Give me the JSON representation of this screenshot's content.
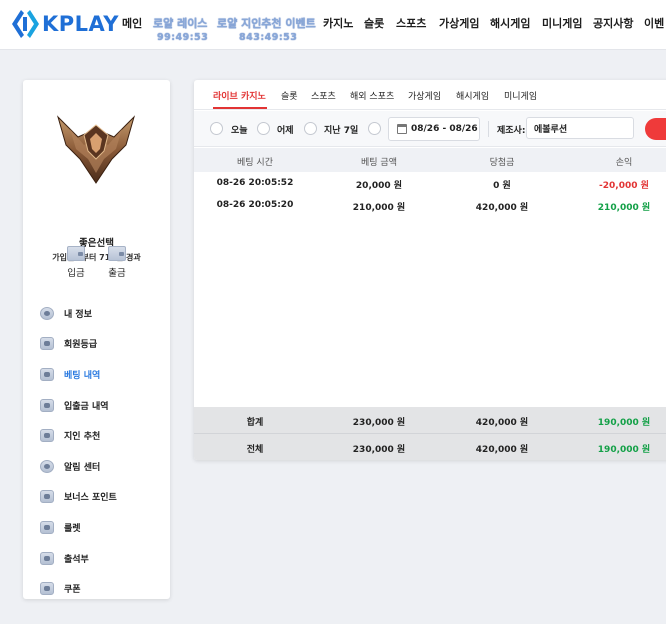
{
  "header": {
    "logo_text": "KPLAY",
    "nav": [
      {
        "label": "메인",
        "event": false
      },
      {
        "label": "로얄 레이스",
        "event": true,
        "timer": "99:49:53"
      },
      {
        "label": "로얄 지인추천 이벤트",
        "event": true,
        "timer": "843:49:53"
      },
      {
        "label": "카지노",
        "event": false
      },
      {
        "label": "슬롯",
        "event": false
      },
      {
        "label": "스포츠",
        "event": false
      },
      {
        "label": "가상게임",
        "event": false
      },
      {
        "label": "해시게임",
        "event": false
      },
      {
        "label": "미니게임",
        "event": false
      },
      {
        "label": "공지사항",
        "event": false
      },
      {
        "label": "이벤",
        "event": false
      }
    ]
  },
  "profile": {
    "username": "좋은선택",
    "joined": "가입일로부터 719일 경과",
    "deposit_label": "입금",
    "withdraw_label": "출금"
  },
  "menu": [
    {
      "label": "내 정보",
      "icon": "user-icon",
      "active": false
    },
    {
      "label": "회원등급",
      "icon": "badge-icon",
      "active": false
    },
    {
      "label": "베팅 내역",
      "icon": "betting-history-icon",
      "active": true
    },
    {
      "label": "입출금 내역",
      "icon": "wallet-icon",
      "active": false
    },
    {
      "label": "지인 추천",
      "icon": "mail-icon",
      "active": false
    },
    {
      "label": "알림 센터",
      "icon": "chat-icon",
      "active": false
    },
    {
      "label": "보너스 포인트",
      "icon": "bonus-icon",
      "active": false
    },
    {
      "label": "룰렛",
      "icon": "roulette-icon",
      "active": false
    },
    {
      "label": "출석부",
      "icon": "attendance-icon",
      "active": false
    },
    {
      "label": "쿠폰",
      "icon": "coupon-icon",
      "active": false
    }
  ],
  "tabs": [
    "라이브 카지노",
    "슬롯",
    "스포츠",
    "해외 스포츠",
    "가상게임",
    "해시게임",
    "미니게임"
  ],
  "filters": {
    "today": "오늘",
    "yesterday": "어제",
    "last7": "지난 7일",
    "date_range": "08/26 - 08/26",
    "provider_label": "제조사:",
    "provider_value": "에볼루션"
  },
  "table": {
    "columns": [
      "베팅 시간",
      "베팅 금액",
      "당첨금",
      "손익"
    ],
    "rows": [
      {
        "time": "08-26 20:05:52",
        "bet": "20,000 원",
        "win": "0 원",
        "profit": "-20,000 원",
        "profit_sign": "neg"
      },
      {
        "time": "08-26 20:05:20",
        "bet": "210,000 원",
        "win": "420,000 원",
        "profit": "210,000 원",
        "profit_sign": "pos"
      }
    ],
    "totals": [
      {
        "label": "합계",
        "bet": "230,000 원",
        "win": "420,000 원",
        "profit": "190,000 원"
      },
      {
        "label": "전체",
        "bet": "230,000 원",
        "win": "420,000 원",
        "profit": "190,000 원"
      }
    ]
  },
  "colors": {
    "accent_red": "#e23434",
    "accent_blue": "#2c7be0",
    "profit_green": "#13a047"
  }
}
